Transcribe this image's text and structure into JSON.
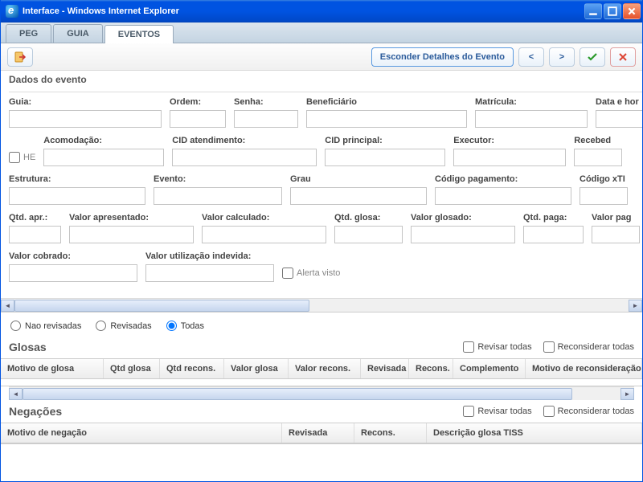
{
  "window": {
    "title": "Interface - Windows Internet Explorer"
  },
  "tabs": [
    "PEG",
    "GUIA",
    "EVENTOS"
  ],
  "active_tab": 2,
  "toolbar": {
    "esconder": "Esconder Detalhes do Evento",
    "prev": "<",
    "next": ">"
  },
  "section_dados": "Dados do evento",
  "fields": {
    "guia": "Guia:",
    "ordem": "Ordem:",
    "senha": "Senha:",
    "beneficiario": "Beneficiário",
    "matricula": "Matrícula:",
    "data_hora": "Data e hor",
    "he": "HE",
    "acomodacao": "Acomodação:",
    "cid_atend": "CID atendimento:",
    "cid_princ": "CID principal:",
    "executor": "Executor:",
    "recebed": "Recebed",
    "estrutura": "Estrutura:",
    "evento": "Evento:",
    "grau": "Grau",
    "codigo_pag": "Código pagamento:",
    "codigo_xth": "Código xTI",
    "qtd_apr": "Qtd. apr.:",
    "valor_apresentado": "Valor apresentado:",
    "valor_calculado": "Valor calculado:",
    "qtd_glosa": "Qtd. glosa:",
    "valor_glosado": "Valor glosado:",
    "qtd_paga": "Qtd. paga:",
    "valor_pag": "Valor pag",
    "valor_cobrado": "Valor cobrado:",
    "valor_utiliz": "Valor utilização indevida:",
    "alerta_visto": "Alerta visto"
  },
  "radios": {
    "nao_revisadas": "Nao revisadas",
    "revisadas": "Revisadas",
    "todas": "Todas"
  },
  "glosas": {
    "title": "Glosas",
    "revisar_todas": "Revisar todas",
    "reconsiderar_todas": "Reconsiderar todas",
    "cols": [
      "Motivo de glosa",
      "Qtd glosa",
      "Qtd recons.",
      "Valor glosa",
      "Valor recons.",
      "Revisada",
      "Recons.",
      "Complemento",
      "Motivo de reconsideração"
    ]
  },
  "negacoes": {
    "title": "Negações",
    "revisar_todas": "Revisar todas",
    "reconsiderar_todas": "Reconsiderar todas",
    "cols": [
      "Motivo de negação",
      "Revisada",
      "Recons.",
      "Descrição glosa TISS"
    ]
  }
}
